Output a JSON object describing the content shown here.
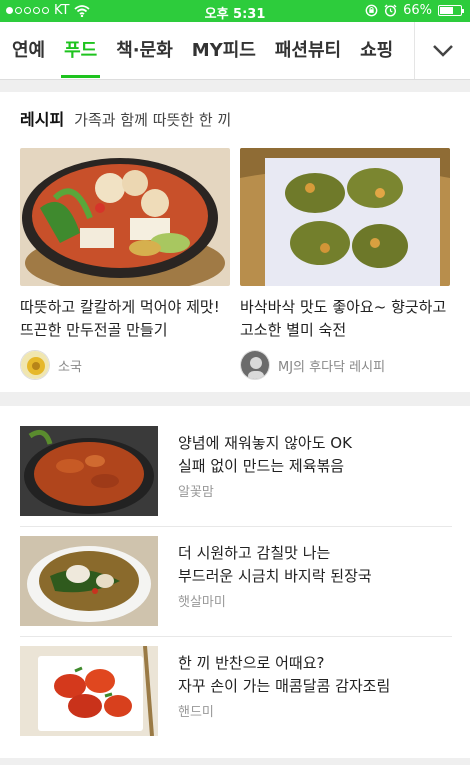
{
  "status_bar": {
    "carrier": "KT",
    "time": "오후 5:31",
    "battery": "66%",
    "battery_level": 0.66
  },
  "tabs": {
    "items": [
      {
        "label": "연예"
      },
      {
        "label": "푸드",
        "active": true
      },
      {
        "label": "책·문화"
      },
      {
        "label": "MY피드"
      },
      {
        "label": "패션뷰티"
      },
      {
        "label": "쇼핑"
      }
    ],
    "more_icon": "chevron-down-icon"
  },
  "recipe_section": {
    "label": "레시피",
    "subtitle": "가족과 함께 따뜻한 한 끼",
    "cards": [
      {
        "title": "따뜻하고 칼칼하게 먹어야 제맛! 뜨끈한 만두전골 만들기",
        "author": "소국"
      },
      {
        "title": "바삭바삭 맛도 좋아요~ 향긋하고 고소한 별미 숙전",
        "author": "MJ의 후다닥 레시피"
      }
    ]
  },
  "list_section": {
    "items": [
      {
        "title_line1": "양념에 재워놓지 않아도 OK",
        "title_line2": "실패 없이 만드는 제육볶음",
        "author": "알꽃맘"
      },
      {
        "title_line1": "더 시원하고 감칠맛 나는",
        "title_line2": "부드러운 시금치 바지락 된장국",
        "author": "햇살마미"
      },
      {
        "title_line1": "한 끼 반찬으로 어때요?",
        "title_line2": "자꾸 손이 가는 매콤달콤 감자조림",
        "author": "핸드미"
      }
    ]
  },
  "colors": {
    "status_bar": "#2dcc3c",
    "accent": "#1ec31e"
  }
}
